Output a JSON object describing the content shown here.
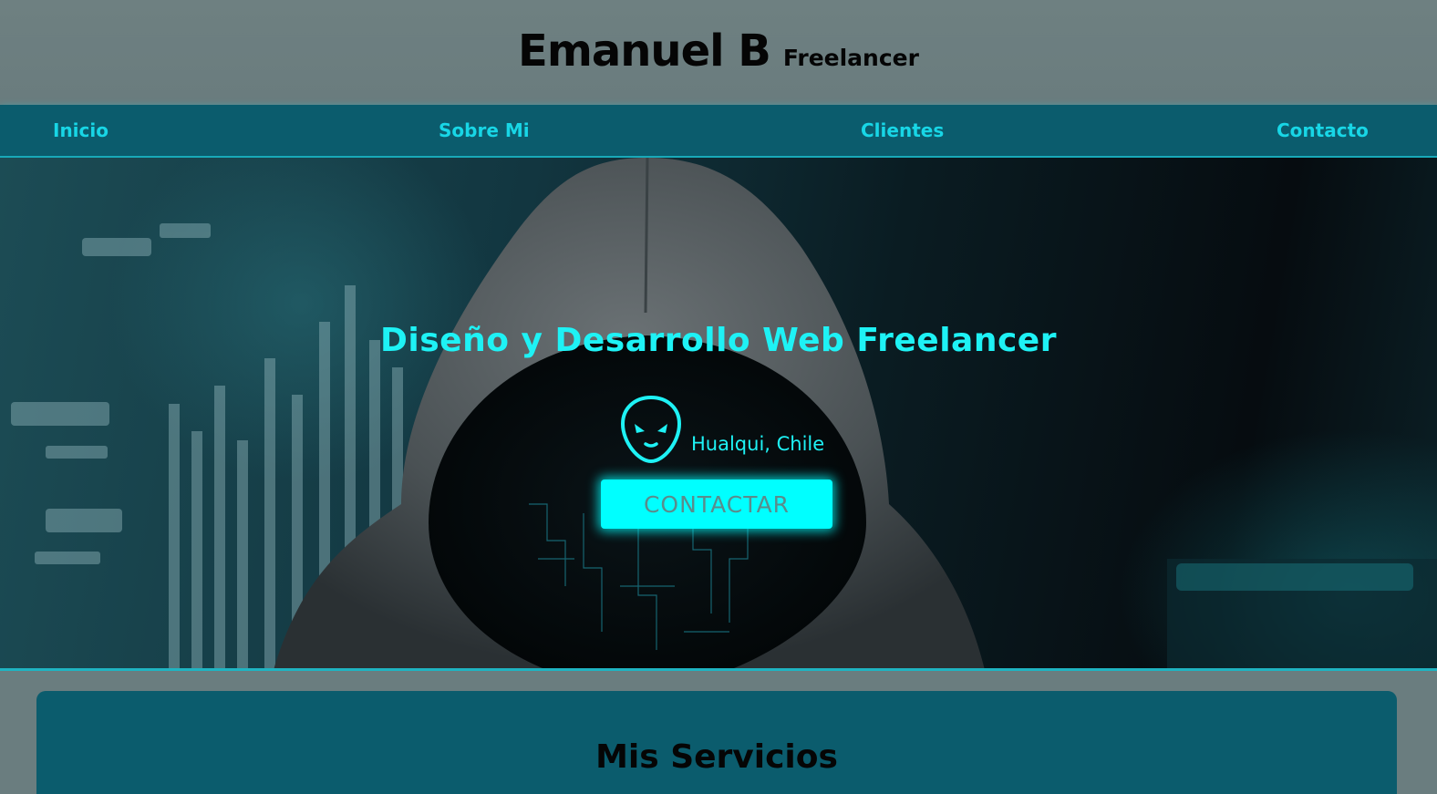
{
  "header": {
    "name": "Emanuel B",
    "tagline": "Freelancer"
  },
  "nav": {
    "items": [
      "Inicio",
      "Sobre Mi",
      "Clientes",
      "Contacto"
    ]
  },
  "hero": {
    "title": "Diseño y Desarrollo Web Freelancer",
    "location_icon": "alien-face-icon",
    "location": "Hualqui, Chile",
    "cta_label": "CONTACTAR"
  },
  "services": {
    "title": "Mis Servicios"
  },
  "colors": {
    "accent": "#1ef2f5",
    "nav_bg": "#0b5c6d",
    "header_bg": "#6e8081",
    "button_bg": "#00ffff"
  }
}
